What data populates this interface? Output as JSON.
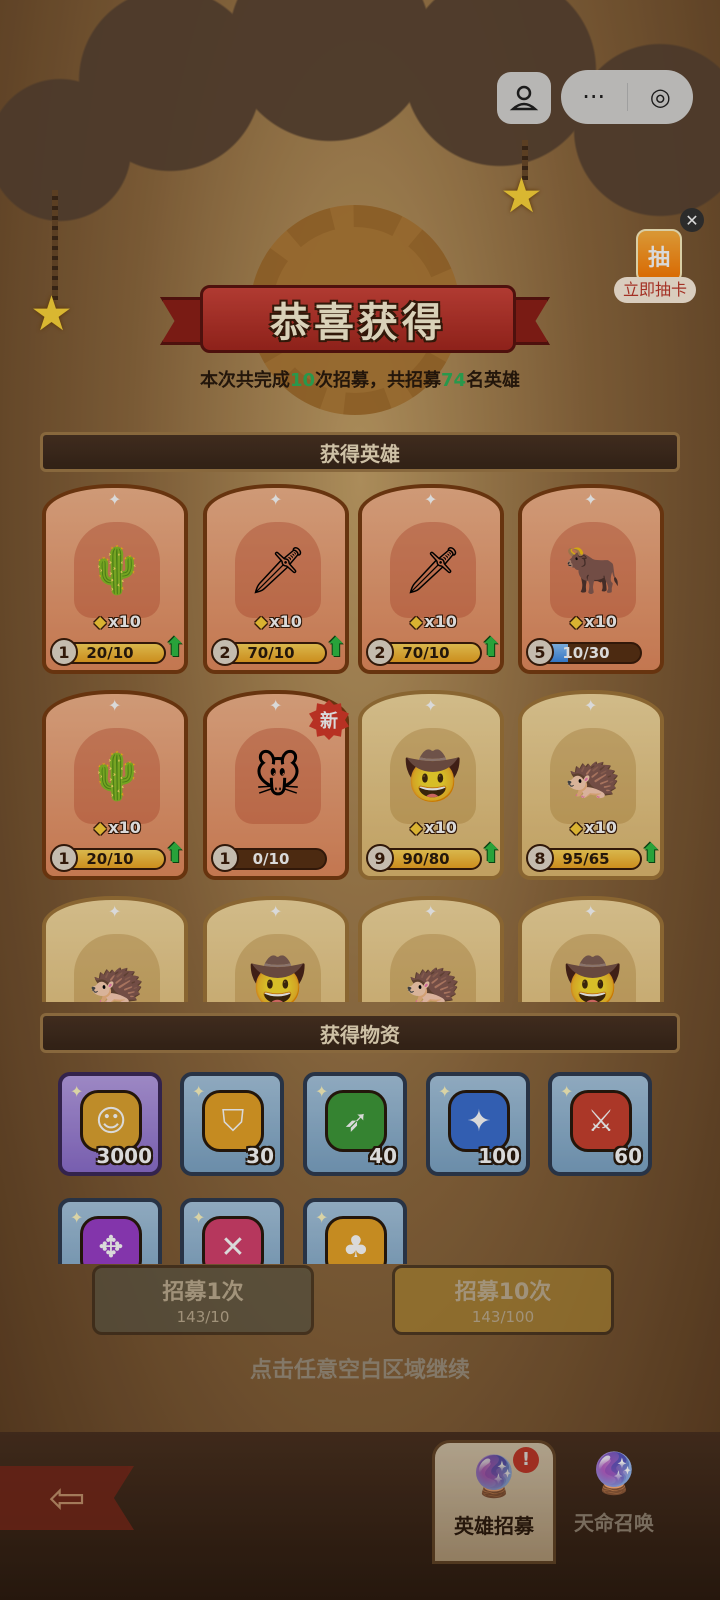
{
  "title": "恭喜获得",
  "summary": {
    "pre": "本次共完成",
    "count": "10",
    "mid": "次招募，共招募",
    "heroes": "74",
    "post": "名英雄"
  },
  "draw_float": {
    "chip": "抽",
    "label": "立即抽卡"
  },
  "sections": {
    "heroes": "获得英雄",
    "items": "获得物资"
  },
  "heroes": [
    {
      "icon": "🌵",
      "mult": "x10",
      "level": "1",
      "progress": "20/10",
      "fill": 1.0,
      "upgrade": true,
      "rarity": "orange"
    },
    {
      "icon": "🗡",
      "mult": "x10",
      "level": "2",
      "progress": "70/10",
      "fill": 1.0,
      "upgrade": true,
      "rarity": "orange"
    },
    {
      "icon": "🗡",
      "mult": "x10",
      "level": "2",
      "progress": "70/10",
      "fill": 1.0,
      "upgrade": true,
      "rarity": "orange"
    },
    {
      "icon": "🐂",
      "mult": "x10",
      "level": "5",
      "progress": "10/30",
      "fill": 0.33,
      "upgrade": false,
      "rarity": "orange",
      "bar": "blue"
    },
    {
      "icon": "🌵",
      "mult": "x10",
      "level": "1",
      "progress": "20/10",
      "fill": 1.0,
      "upgrade": true,
      "rarity": "orange"
    },
    {
      "icon": "🐭",
      "mult": "",
      "level": "1",
      "progress": "0/10",
      "fill": 0.0,
      "upgrade": false,
      "rarity": "orange",
      "new": "新"
    },
    {
      "icon": "🤠",
      "mult": "x10",
      "level": "9",
      "progress": "90/80",
      "fill": 1.0,
      "upgrade": true,
      "rarity": "gold"
    },
    {
      "icon": "🦔",
      "mult": "x10",
      "level": "8",
      "progress": "95/65",
      "fill": 1.0,
      "upgrade": true,
      "rarity": "gold"
    },
    {
      "icon": "🦔",
      "mult": "",
      "level": "",
      "progress": "",
      "fill": 0,
      "upgrade": false,
      "rarity": "gold"
    },
    {
      "icon": "🤠",
      "mult": "",
      "level": "",
      "progress": "",
      "fill": 0,
      "upgrade": false,
      "rarity": "gold"
    },
    {
      "icon": "🦔",
      "mult": "",
      "level": "",
      "progress": "",
      "fill": 0,
      "upgrade": false,
      "rarity": "gold"
    },
    {
      "icon": "🤠",
      "mult": "",
      "level": "",
      "progress": "",
      "fill": 0,
      "upgrade": false,
      "rarity": "gold"
    }
  ],
  "items": [
    {
      "name": "coin-icon",
      "glyph": "☺",
      "qty": "3000",
      "color": "#e0a531",
      "bg": "purple"
    },
    {
      "name": "shield-gem-icon",
      "glyph": "⛉",
      "qty": "30",
      "color": "#e8a427",
      "bg": "blue"
    },
    {
      "name": "bow-gem-icon",
      "glyph": "➶",
      "qty": "40",
      "color": "#3f9a3a",
      "bg": "blue"
    },
    {
      "name": "wizard-gem-icon",
      "glyph": "✦",
      "qty": "100",
      "color": "#3b6fd1",
      "bg": "blue"
    },
    {
      "name": "sword-gem-icon",
      "glyph": "⚔",
      "qty": "60",
      "color": "#c9412f",
      "bg": "blue"
    },
    {
      "name": "shuriken-gem-icon",
      "glyph": "✥",
      "qty": "",
      "color": "#9b3fc9",
      "bg": "blue"
    },
    {
      "name": "cross-gem-icon",
      "glyph": "✕",
      "qty": "",
      "color": "#d6416e",
      "bg": "blue"
    },
    {
      "name": "gold-coin-icon",
      "glyph": "♣",
      "qty": "",
      "color": "#e8a427",
      "bg": "blue"
    }
  ],
  "recruit": {
    "one": {
      "label": "招募1次",
      "cost": "143/10"
    },
    "ten": {
      "label": "招募10次",
      "cost": "143/100"
    }
  },
  "continue_hint": "点击任意空白区域继续",
  "nav": {
    "active": "英雄招募",
    "other": "天命召唤",
    "alert": "!"
  },
  "capsule": {
    "more": "···",
    "record": "◎"
  }
}
